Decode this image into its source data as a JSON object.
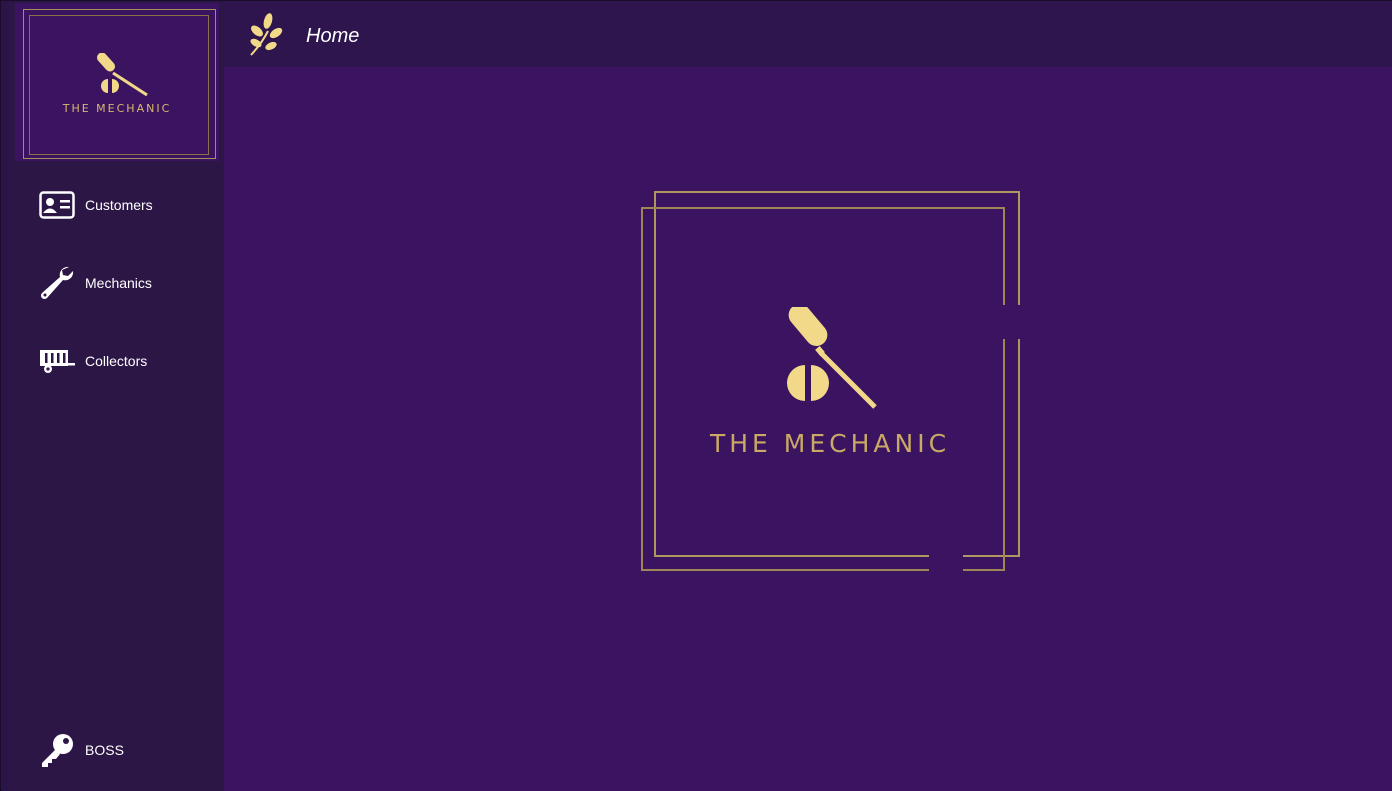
{
  "brand": {
    "name": "THE MECHANIC"
  },
  "header": {
    "title": "Home",
    "icon": "leaf-icon"
  },
  "sidebar": {
    "items": [
      {
        "label": "Customers",
        "icon": "id-card-icon"
      },
      {
        "label": "Mechanics",
        "icon": "wrench-icon"
      },
      {
        "label": "Collectors",
        "icon": "trailer-icon"
      }
    ],
    "bottom_item": {
      "label": "BOSS",
      "icon": "key-icon"
    }
  },
  "colors": {
    "background": "#3a1460",
    "sidebar": "#2c1646",
    "topbar": "#2e154e",
    "gold": "#f2d98a",
    "frame": "#b09660",
    "text": "#ffffff"
  }
}
